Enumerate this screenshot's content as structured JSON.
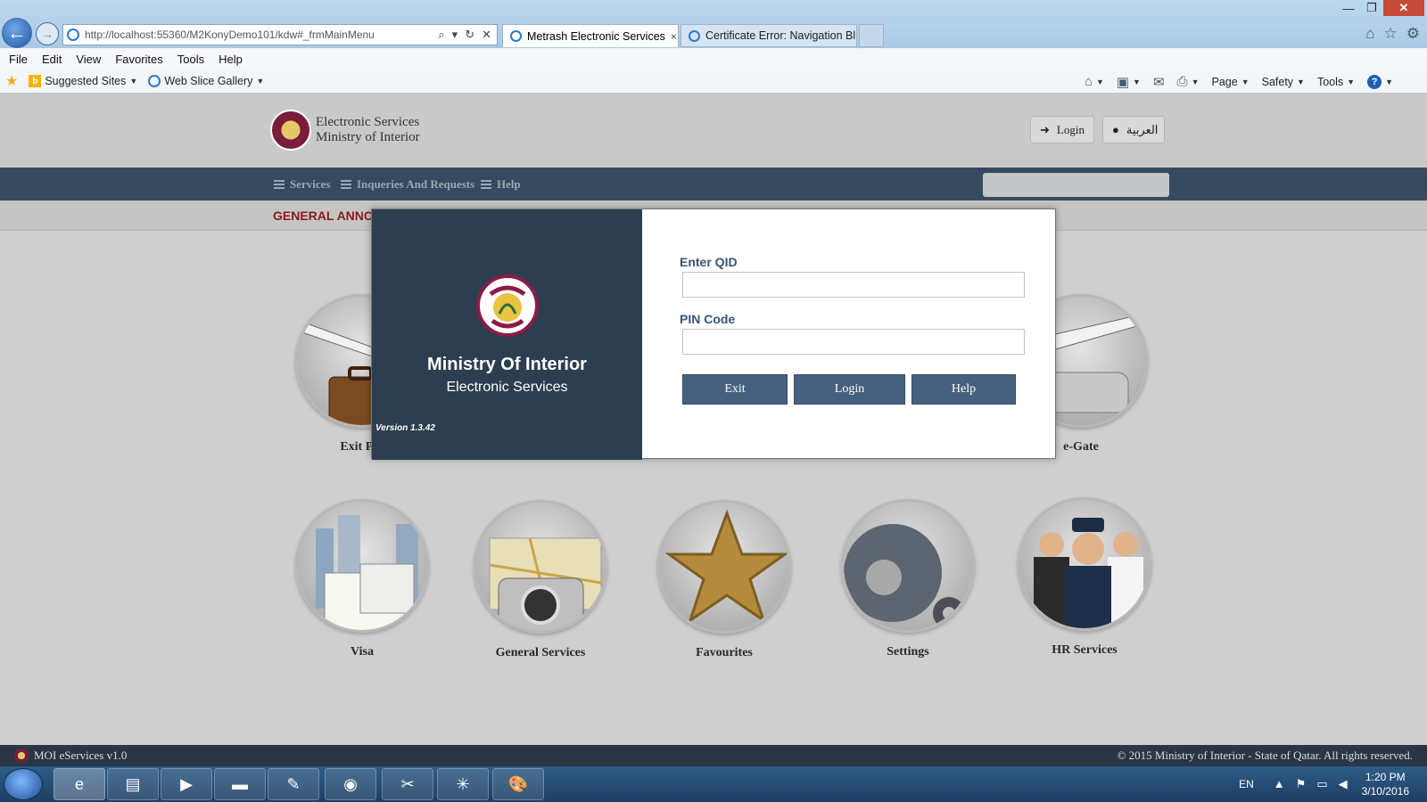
{
  "browser": {
    "address": "http://localhost:55360/M2KonyDemo101/kdw#_frmMainMenu",
    "tabs": [
      {
        "label": "Metrash Electronic Services",
        "close": "×"
      },
      {
        "label": "Certificate Error: Navigation Bl..."
      }
    ],
    "window_controls": {
      "minimize": "—",
      "maximize": "❐",
      "close": "✕"
    },
    "menu": [
      "File",
      "Edit",
      "View",
      "Favorites",
      "Tools",
      "Help"
    ],
    "favorites": {
      "suggested": "Suggested Sites",
      "webslice": "Web Slice Gallery"
    },
    "commands": {
      "page": "Page",
      "safety": "Safety",
      "tools": "Tools",
      "help": "?"
    }
  },
  "site": {
    "title_line1": "Electronic Services",
    "title_line2": "Ministry of Interior",
    "login_label": "Login",
    "language_label": "العربية",
    "nav": {
      "services": "Services",
      "inquiries": "Inqueries And Requests",
      "help": "Help"
    },
    "announcement_label": "GENERAL ANNO"
  },
  "tiles": [
    {
      "label": "Exit Per"
    },
    {
      "label": "e-Gate"
    },
    {
      "label": "Visa"
    },
    {
      "label": "General Services"
    },
    {
      "label": "Favourites"
    },
    {
      "label": "Settings"
    },
    {
      "label": "HR Services"
    }
  ],
  "modal": {
    "title": "Ministry Of Interior",
    "subtitle": "Electronic Services",
    "version": "Version 1.3.42",
    "qid_label": "Enter QID",
    "qid_value": "",
    "pin_label": "PIN Code",
    "pin_value": "",
    "exit_label": "Exit",
    "login_label": "Login",
    "help_label": "Help"
  },
  "footer": {
    "left": "MOI eServices v1.0",
    "right": "© 2015 Ministry of Interior - State of Qatar. All rights reserved."
  },
  "taskbar": {
    "lang": "EN",
    "time": "1:20 PM",
    "date": "3/10/2016"
  },
  "colors": {
    "navbar": "#354a5e",
    "modal_panel": "#2c3e50",
    "modal_button": "#46617f",
    "announcement": "#8a1a1a"
  }
}
